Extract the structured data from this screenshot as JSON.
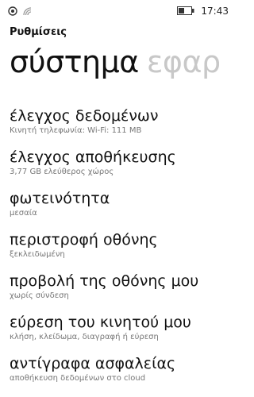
{
  "status_bar": {
    "time": "17:43",
    "icons": [
      "sim-signal-icon",
      "wifi-icon",
      "battery-icon"
    ]
  },
  "header": {
    "app_title": "Ρυθμίσεις",
    "pivot_active": "σύστημα",
    "pivot_next": "εφαρ"
  },
  "settings": [
    {
      "title": "έλεγχος δεδομένων",
      "subtitle": "Κινητή τηλεφωνία:  Wi-Fi: 111 MB"
    },
    {
      "title": "έλεγχος αποθήκευσης",
      "subtitle": "3,77 GB ελεύθερος χώρος"
    },
    {
      "title": "φωτεινότητα",
      "subtitle": "μεσαία"
    },
    {
      "title": "περιστροφή οθόνης",
      "subtitle": "ξεκλειδωμένη"
    },
    {
      "title": "προβολή της οθόνης μου",
      "subtitle": "χωρίς σύνδεση"
    },
    {
      "title": "εύρεση του κινητού μου",
      "subtitle": "κλήση, κλείδωμα, διαγραφή ή εύρεση"
    },
    {
      "title": "αντίγραφα ασφαλείας",
      "subtitle": "αποθήκευση δεδομένων στο cloud"
    }
  ]
}
